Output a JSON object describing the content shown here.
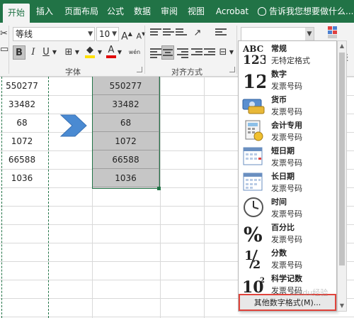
{
  "tabs": [
    {
      "label": "开始",
      "active": true
    },
    {
      "label": "插入"
    },
    {
      "label": "页面布局"
    },
    {
      "label": "公式"
    },
    {
      "label": "数据"
    },
    {
      "label": "审阅"
    },
    {
      "label": "视图"
    },
    {
      "label": "Acrobat"
    }
  ],
  "tell_me": "告诉我您想要做什么...",
  "ribbon": {
    "font_name": "等线",
    "font_size": "10",
    "font_group_label": "字体",
    "align_group_label": "对齐方式",
    "number_format_value": "",
    "grow_label": "A",
    "shrink_label": "A",
    "bold": "B",
    "italic": "I",
    "underline": "U",
    "font_color_label": "A",
    "phonetic_label": "wén",
    "right_partial": "表"
  },
  "colors": {
    "ribbon_green": "#217346",
    "selection_gray": "#c6c6c6",
    "highlight_red": "#e0443c",
    "arrow_blue": "#4a8ad2"
  },
  "cells": {
    "left": [
      "550277",
      "33482",
      "68",
      "1072",
      "66588",
      "1036"
    ],
    "selected": [
      "550277",
      "33482",
      "68",
      "1072",
      "66588",
      "1036"
    ]
  },
  "number_formats": [
    {
      "title": "常规",
      "subtitle": "无特定格式",
      "icon": "abc123-icon"
    },
    {
      "title": "数字",
      "subtitle": "发票号码",
      "icon": "number-12-icon"
    },
    {
      "title": "货币",
      "subtitle": "发票号码",
      "icon": "currency-icon"
    },
    {
      "title": "会计专用",
      "subtitle": "发票号码",
      "icon": "accounting-icon"
    },
    {
      "title": "短日期",
      "subtitle": "发票号码",
      "icon": "short-date-icon"
    },
    {
      "title": "长日期",
      "subtitle": "发票号码",
      "icon": "long-date-icon"
    },
    {
      "title": "时间",
      "subtitle": "发票号码",
      "icon": "clock-icon"
    },
    {
      "title": "百分比",
      "subtitle": "发票号码",
      "icon": "percent-icon"
    },
    {
      "title": "分数",
      "subtitle": "发票号码",
      "icon": "fraction-icon"
    },
    {
      "title": "科学记数",
      "subtitle": "发票号码",
      "icon": "scientific-icon"
    }
  ],
  "more_formats": "其他数字格式(M)...",
  "watermark": "Baidu经验"
}
